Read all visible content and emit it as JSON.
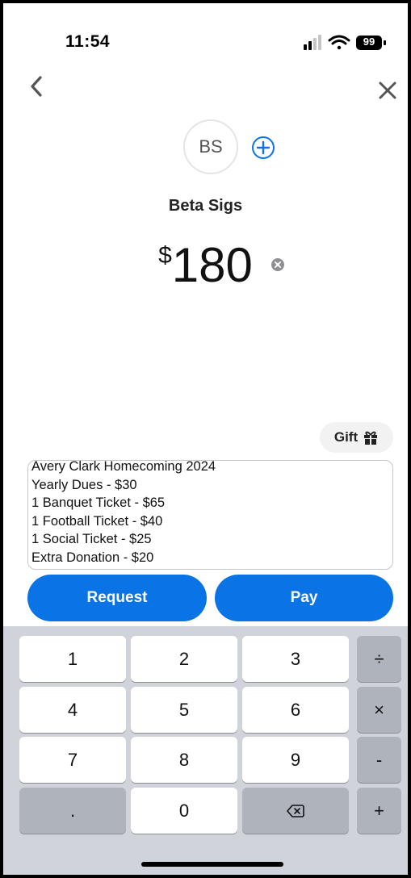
{
  "status_bar": {
    "time": "11:54",
    "battery": "99"
  },
  "recipient": {
    "initials": "BS",
    "name": "Beta Sigs"
  },
  "amount": {
    "currency": "$",
    "value": "180"
  },
  "gift": {
    "label": "Gift"
  },
  "note": {
    "lines": [
      "Avery Clark Homecoming 2024",
      "Yearly Dues - $30",
      "1 Banquet Ticket - $65",
      "1 Football Ticket - $40",
      "1 Social Ticket - $25",
      "Extra Donation - $20"
    ]
  },
  "actions": {
    "request_label": "Request",
    "pay_label": "Pay"
  },
  "keypad": {
    "row1": [
      "1",
      "2",
      "3",
      "÷"
    ],
    "row2": [
      "4",
      "5",
      "6",
      "×"
    ],
    "row3": [
      "7",
      "8",
      "9",
      "-"
    ],
    "row4": [
      ".",
      "0",
      "",
      "+"
    ],
    "backspace_icon": "delete-left-icon"
  },
  "colors": {
    "accent": "#0a74e6",
    "keyboard_bg": "#d0d3d9",
    "key_dark": "#aeb3bc"
  }
}
